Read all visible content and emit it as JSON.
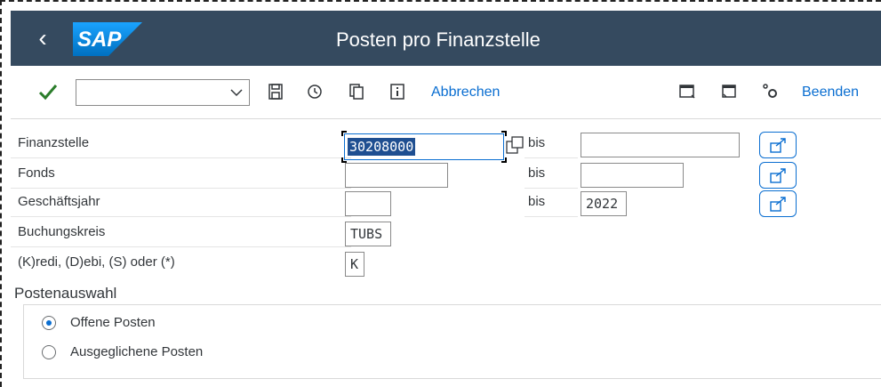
{
  "titlebar": {
    "title": "Posten pro Finanzstelle",
    "logo_text": "SAP"
  },
  "toolbar": {
    "command_field_value": "",
    "cancel_label": "Abbrechen",
    "exit_label": "Beenden"
  },
  "form": {
    "rows": [
      {
        "label": "Finanzstelle",
        "value": "30208000",
        "bis_label": "bis",
        "bis_value": ""
      },
      {
        "label": "Fonds",
        "value": "",
        "bis_label": "bis",
        "bis_value": ""
      },
      {
        "label": "Geschäftsjahr",
        "value": "",
        "bis_label": "bis",
        "bis_value": "2022"
      },
      {
        "label": "Buchungskreis",
        "value": "TUBS"
      },
      {
        "label": "(K)redi, (D)ebi, (S) oder (*)",
        "value": "K"
      }
    ]
  },
  "postenauswahl": {
    "title": "Postenauswahl",
    "options": [
      {
        "label": "Offene Posten",
        "selected": true
      },
      {
        "label": "Ausgeglichene Posten",
        "selected": false
      }
    ]
  },
  "colors": {
    "shell_header": "#354a5f",
    "accent": "#0a6ed1",
    "check_green": "#2b7d2b",
    "selection": "#1f4f91"
  }
}
